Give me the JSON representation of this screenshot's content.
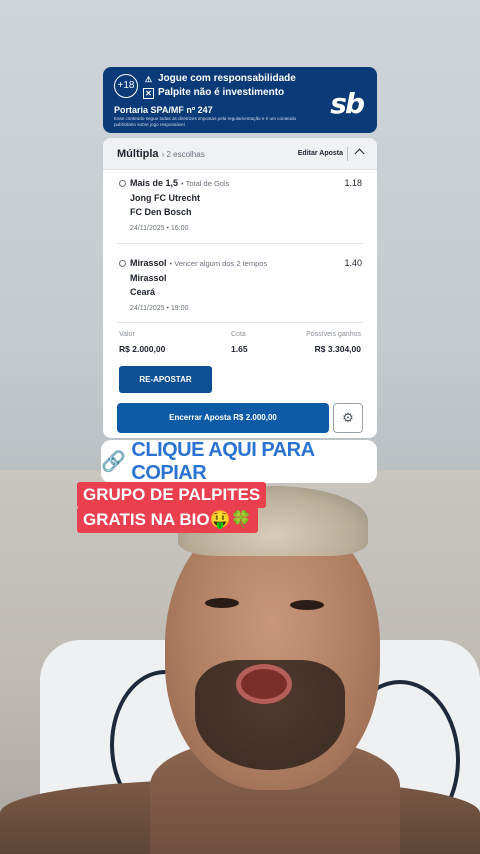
{
  "banner": {
    "age": "+18",
    "line1": "Jogue com responsabilidade",
    "line2": "Palpite não é investimento",
    "portaria": "Portaria SPA/MF nº 247",
    "disclaimer": "Esse conteúdo segue todas as diretrizes impostas pela regulamentação e é um conteúdo publicitário sobre jogo responsável",
    "logo": "sb"
  },
  "bet": {
    "title": "Múltipla",
    "choices": "› 2 escolhas",
    "edit": "Editar Aposta",
    "selections": [
      {
        "market": "Mais de 1,5",
        "type": "• Total de Gols",
        "odd": "1.18",
        "home": "Jong FC Utrecht",
        "away": "FC Den Bosch",
        "date": "24/11/2025 • 16:00"
      },
      {
        "market": "Mirassol",
        "type": "• Vencer algum dos 2 tempos",
        "odd": "1.40",
        "home": "Mirassol",
        "away": "Ceará",
        "date": "24/11/2025 • 19:00"
      }
    ],
    "summary": {
      "valor_label": "Valor",
      "valor": "R$ 2.000,00",
      "cota_label": "Cota",
      "cota": "1.65",
      "ganhos_label": "Possíveis ganhos",
      "ganhos": "R$ 3.304,00"
    },
    "reapostar": "RE-APOSTAR",
    "encerrar": "Encerrar Aposta R$ 2.000,00"
  },
  "copy": {
    "icon": "link-icon",
    "label": "CLIQUE AQUI PARA COPIAR"
  },
  "promo": {
    "line1": "GRUPO DE PALPITES",
    "line2": "GRATIS NA BIO🤑🍀"
  }
}
